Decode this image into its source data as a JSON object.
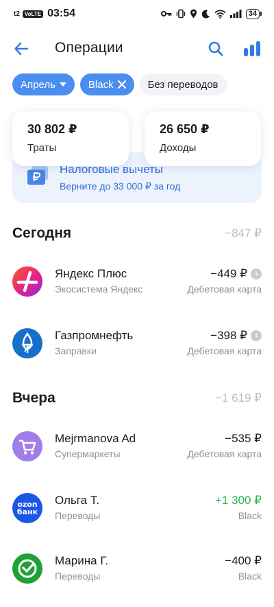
{
  "status_bar": {
    "carrier": "t2",
    "network_badge": "VoLTE",
    "time": "03:54",
    "battery": "34",
    "icons": [
      "key-icon",
      "vibrate-icon",
      "location-icon",
      "moon-icon",
      "wifi-icon",
      "signal-icon",
      "battery-icon"
    ]
  },
  "header": {
    "title": "Операции",
    "icons": [
      "back-arrow-icon",
      "search-icon",
      "bar-chart-icon"
    ]
  },
  "filters": {
    "month": "Апрель",
    "card": "Black",
    "transfers": "Без переводов"
  },
  "summary": {
    "spent_amount": "30 802 ₽",
    "spent_label": "Траты",
    "income_amount": "26 650 ₽",
    "income_label": "Доходы"
  },
  "promo": {
    "title": "Налоговые вычеты",
    "subtitle": "Верните до 33 000 ₽ за год",
    "icon": "ruble-card-icon"
  },
  "colors": {
    "accent": "#4a8ef0",
    "income": "#2db34a",
    "muted": "#8e9196"
  },
  "sections": [
    {
      "title": "Сегодня",
      "total": "−847 ₽",
      "items": [
        {
          "name": "Яндекс Плюс",
          "category": "Экосистема Яндекс",
          "amount": "−449 ₽",
          "source": "Дебетовая карта",
          "icon": "yandex-plus-icon",
          "pending": true
        },
        {
          "name": "Газпромнефть",
          "category": "Заправки",
          "amount": "−398 ₽",
          "source": "Дебетовая карта",
          "icon": "gazpromneft-icon",
          "pending": true
        }
      ]
    },
    {
      "title": "Вчера",
      "total": "−1 619 ₽",
      "items": [
        {
          "name": "Mejrmanova Ad",
          "category": "Супермаркеты",
          "amount": "−535 ₽",
          "source": "Дебетовая карта",
          "icon": "shopping-cart-icon",
          "pending": false
        },
        {
          "name": "Ольга Т.",
          "category": "Переводы",
          "amount": "+1 300 ₽",
          "source": "Black",
          "icon": "ozon-bank-icon",
          "logo_text": [
            "ozon",
            "банк"
          ],
          "pending": false
        },
        {
          "name": "Марина Г.",
          "category": "Переводы",
          "amount": "−400 ₽",
          "source": "Black",
          "icon": "sber-icon",
          "pending": false
        }
      ]
    }
  ]
}
